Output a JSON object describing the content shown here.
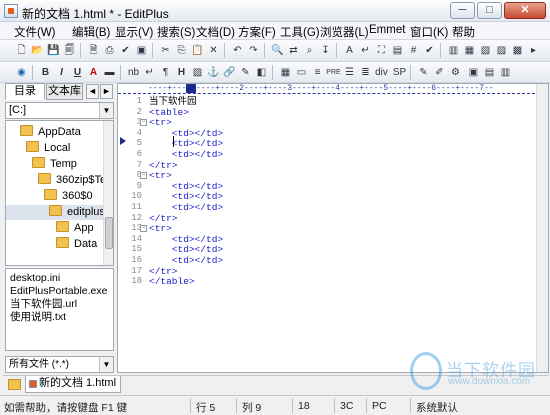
{
  "window": {
    "title": "新的文档 1.html * - EditPlus",
    "min": "─",
    "max": "□",
    "close": "✕"
  },
  "menu": [
    "文件(W)",
    "编辑(B)",
    "显示(V)",
    "搜索(S)",
    "文档(D)",
    "方案(F)",
    "工具(G)",
    "浏览器(L)",
    "Emmet",
    "窗口(K)",
    "帮助"
  ],
  "toolbar2_labels": {
    "bold": "B",
    "italic": "I",
    "underline": "U",
    "font": "A",
    "nbsp": "nb",
    "para": "¶",
    "heading": "H",
    "pre": "PRE",
    "div": "div",
    "span": "SP"
  },
  "sidebar": {
    "tabs": [
      "目录",
      "文本库"
    ],
    "nav": [
      "◄",
      "►"
    ],
    "drive": "[C:]",
    "tree": [
      "AppData",
      "Local",
      "Temp",
      "360zip$Te",
      "360$0",
      "editplus",
      "App",
      "Data"
    ],
    "files": [
      "desktop.ini",
      "EditPlusPortable.exe",
      "当下软件园.url",
      "使用说明.txt"
    ],
    "filter": "所有文件 (*.*)"
  },
  "ruler": "----+----1----+----2----+----3----+----4----+----5----+----6----+----7--",
  "editor": {
    "lines": [
      {
        "n": "1",
        "fold": "",
        "text": "当下软件园",
        "kind": "txt"
      },
      {
        "n": "2",
        "fold": "",
        "text": "<table>",
        "kind": "tag"
      },
      {
        "n": "3",
        "fold": "⊟",
        "text": "<tr>",
        "kind": "tag"
      },
      {
        "n": "4",
        "fold": "",
        "text": "    <td></td>",
        "kind": "tag"
      },
      {
        "n": "5",
        "fold": "",
        "text": "    <td></td>",
        "kind": "tag"
      },
      {
        "n": "6",
        "fold": "",
        "text": "    <td></td>",
        "kind": "tag"
      },
      {
        "n": "7",
        "fold": "",
        "text": "</tr>",
        "kind": "tag"
      },
      {
        "n": "8",
        "fold": "⊟",
        "text": "<tr>",
        "kind": "tag"
      },
      {
        "n": "9",
        "fold": "",
        "text": "    <td></td>",
        "kind": "tag"
      },
      {
        "n": "10",
        "fold": "",
        "text": "    <td></td>",
        "kind": "tag"
      },
      {
        "n": "11",
        "fold": "",
        "text": "    <td></td>",
        "kind": "tag"
      },
      {
        "n": "12",
        "fold": "",
        "text": "</tr>",
        "kind": "tag"
      },
      {
        "n": "13",
        "fold": "⊟",
        "text": "<tr>",
        "kind": "tag"
      },
      {
        "n": "14",
        "fold": "",
        "text": "    <td></td>",
        "kind": "tag"
      },
      {
        "n": "15",
        "fold": "",
        "text": "    <td></td>",
        "kind": "tag"
      },
      {
        "n": "16",
        "fold": "",
        "text": "    <td></td>",
        "kind": "tag"
      },
      {
        "n": "17",
        "fold": "",
        "text": "</tr>",
        "kind": "tag"
      },
      {
        "n": "18",
        "fold": "",
        "text": "</table>",
        "kind": "tag"
      }
    ]
  },
  "doc_tab": "新的文档 1.html",
  "status": {
    "help": "如需帮助，请按键盘 F1 键",
    "row": "行 5",
    "col": "列 9",
    "lines": "18",
    "code": "3C",
    "mode": "PC",
    "encoding": "系统默认"
  },
  "watermark": {
    "text": "当下软件园",
    "sub": "www.downxia.com"
  }
}
